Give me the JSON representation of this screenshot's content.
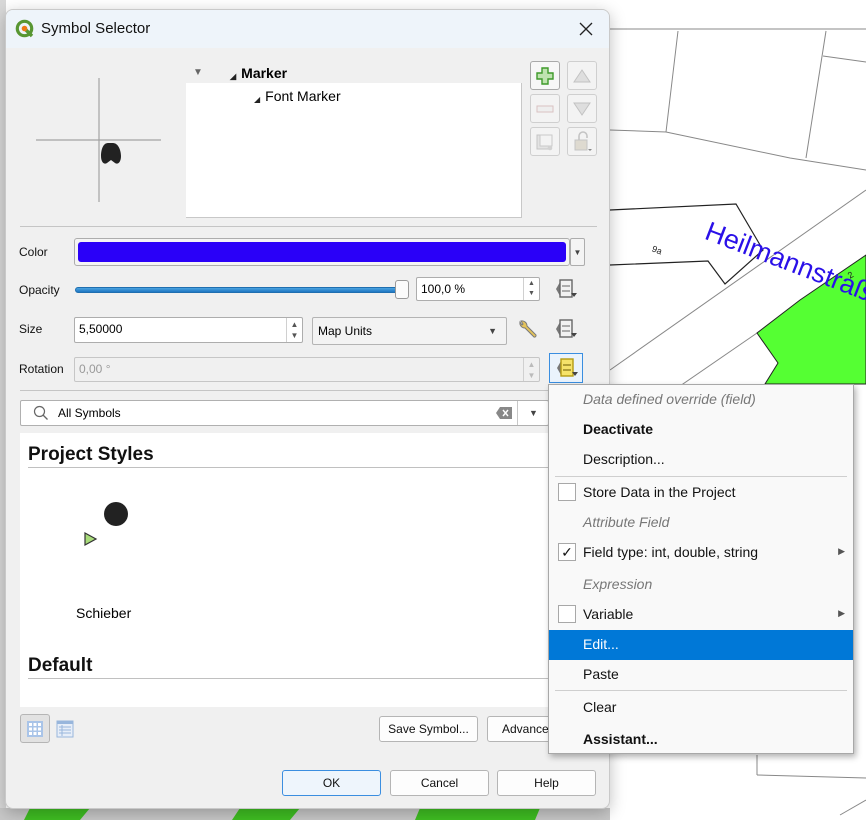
{
  "map": {
    "street_label": "Heilmannstraß",
    "parcel_labels": [
      "9a",
      "2"
    ],
    "colors": {
      "fill_green": "#55ff33",
      "street_label": "#2a10e8"
    }
  },
  "dialog": {
    "title": "Symbol Selector",
    "close_icon": "close-icon",
    "tree": {
      "root_label": "Marker",
      "child_label": "Font Marker"
    },
    "layer_buttons": [
      "add-layer-icon",
      "move-up-icon",
      "remove-layer-icon",
      "move-down-icon",
      "duplicate-layer-icon",
      "lock-icon"
    ],
    "properties": {
      "color_label": "Color",
      "color_value": "#2a00f8",
      "opacity_label": "Opacity",
      "opacity_value": "100,0 %",
      "opacity_fraction": 1.0,
      "size_label": "Size",
      "size_value": "5,50000",
      "size_unit": "Map Units",
      "rotation_label": "Rotation",
      "rotation_value": "0,00 °"
    },
    "search": {
      "value": "All Symbols"
    },
    "symbol_groups": [
      {
        "name": "Project Styles",
        "items": [
          {
            "label": "Schieber"
          }
        ]
      },
      {
        "name": "Default",
        "items": []
      }
    ],
    "buttons": {
      "save_symbol": "Save Symbol...",
      "advanced": "Advanced",
      "ok": "OK",
      "cancel": "Cancel",
      "help": "Help"
    }
  },
  "context_menu": {
    "items": [
      {
        "label": "Data defined override (field)",
        "type": "header"
      },
      {
        "label": "Deactivate",
        "type": "bold"
      },
      {
        "label": "Description...",
        "type": "item"
      },
      {
        "label": "Store Data in the Project",
        "type": "check",
        "checked": false
      },
      {
        "label": "Attribute Field",
        "type": "header"
      },
      {
        "label": "Field type: int, double, string",
        "type": "check",
        "checked": true,
        "submenu": true
      },
      {
        "label": "Expression",
        "type": "header"
      },
      {
        "label": "Variable",
        "type": "check",
        "checked": false,
        "submenu": true
      },
      {
        "label": "Edit...",
        "type": "item",
        "highlighted": true
      },
      {
        "label": "Paste",
        "type": "item"
      },
      {
        "label": "Clear",
        "type": "item"
      },
      {
        "label": "Assistant...",
        "type": "bold"
      }
    ],
    "check_mark": "✓"
  }
}
